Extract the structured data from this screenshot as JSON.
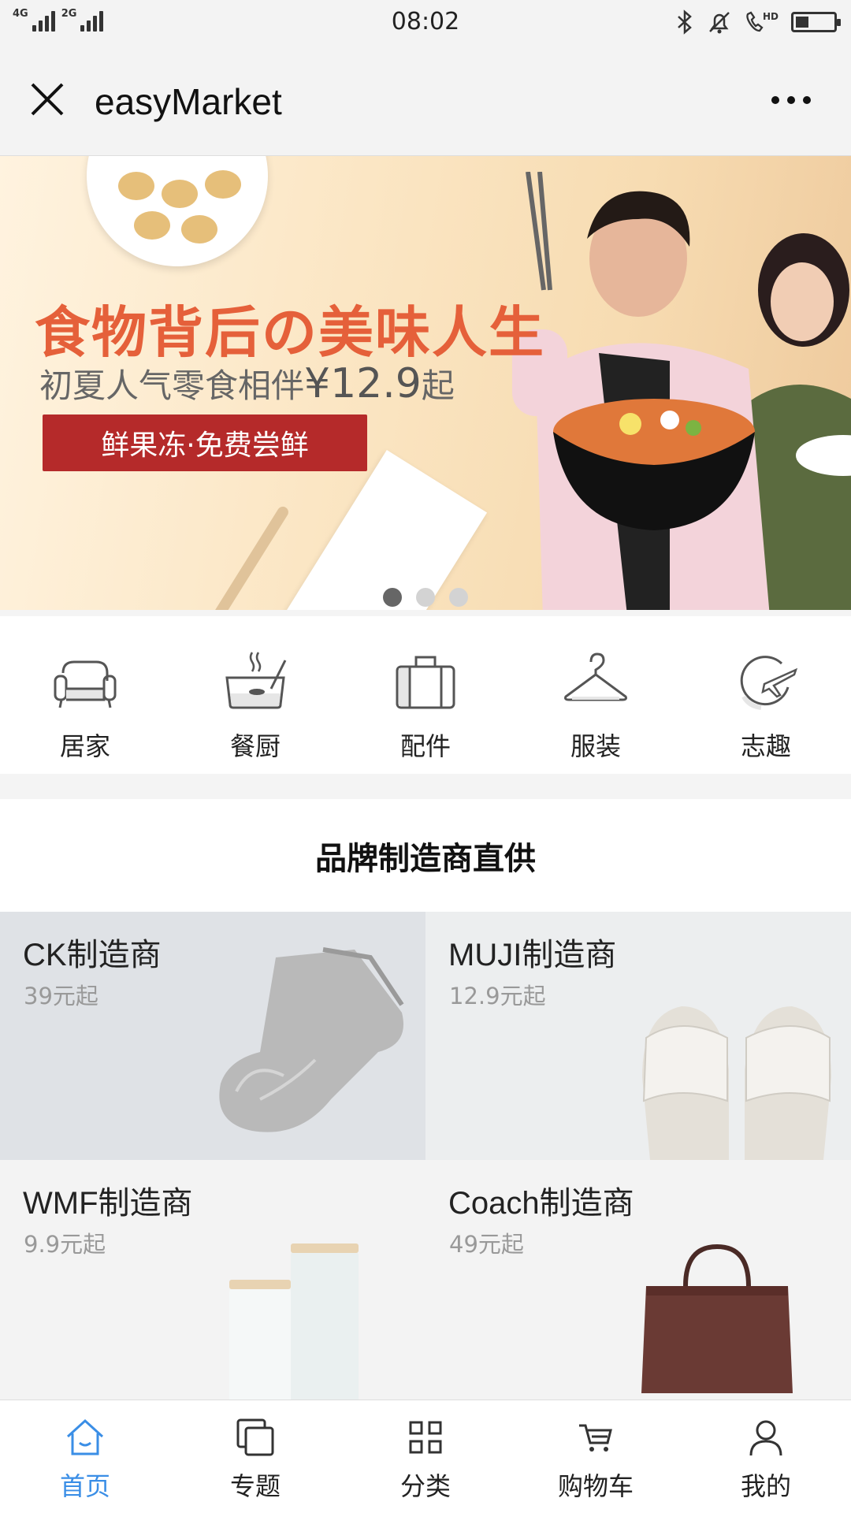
{
  "status_bar": {
    "time": "08:02",
    "signal_1": "4G",
    "signal_2": "2G",
    "network_badge": "HD"
  },
  "titlebar": {
    "title": "easyMarket"
  },
  "banner": {
    "headline": "食物背后の美味人生",
    "subline_prefix": "初夏人气零食相伴",
    "subline_price": "¥12.9",
    "subline_suffix": "起",
    "button_label": "鲜果冻·免费尝鲜",
    "page_count": 3,
    "active_page": 1
  },
  "categories": [
    {
      "label": "居家",
      "icon": "sofa-icon"
    },
    {
      "label": "餐厨",
      "icon": "pot-icon"
    },
    {
      "label": "配件",
      "icon": "suitcase-icon"
    },
    {
      "label": "服装",
      "icon": "hanger-icon"
    },
    {
      "label": "志趣",
      "icon": "globe-plane-icon"
    }
  ],
  "brand_section": {
    "heading": "品牌制造商直供",
    "brands": [
      {
        "name": "CK制造商",
        "price": "39元起",
        "image": "socks"
      },
      {
        "name": "MUJI制造商",
        "price": "12.9元起",
        "image": "slippers"
      },
      {
        "name": "WMF制造商",
        "price": "9.9元起",
        "image": "jars"
      },
      {
        "name": "Coach制造商",
        "price": "49元起",
        "image": "handbag"
      }
    ]
  },
  "tabbar": {
    "active_color": "#3a8ee6",
    "tabs": [
      {
        "label": "首页",
        "icon": "home-icon",
        "active": true
      },
      {
        "label": "专题",
        "icon": "topics-icon",
        "active": false
      },
      {
        "label": "分类",
        "icon": "grid-icon",
        "active": false
      },
      {
        "label": "购物车",
        "icon": "cart-icon",
        "active": false
      },
      {
        "label": "我的",
        "icon": "user-icon",
        "active": false
      }
    ]
  }
}
